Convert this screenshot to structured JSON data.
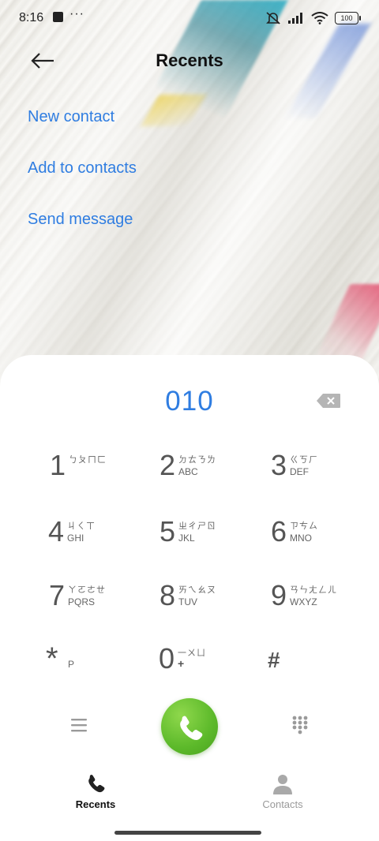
{
  "status_bar": {
    "time": "8:16",
    "more": "···",
    "battery": "100"
  },
  "header": {
    "title": "Recents"
  },
  "actions": {
    "new_contact": "New contact",
    "add_to_contacts": "Add to contacts",
    "send_message": "Send message"
  },
  "dialer": {
    "number": "010",
    "keys": [
      {
        "digit": "1",
        "zhuyin": "ㄅㄆㄇㄈ",
        "letters": ""
      },
      {
        "digit": "2",
        "zhuyin": "ㄉㄊㄋㄌ",
        "letters": "ABC"
      },
      {
        "digit": "3",
        "zhuyin": "ㄍㄎㄏ",
        "letters": "DEF"
      },
      {
        "digit": "4",
        "zhuyin": "ㄐㄑㄒ",
        "letters": "GHI"
      },
      {
        "digit": "5",
        "zhuyin": "ㄓㄔㄕㄖ",
        "letters": "JKL"
      },
      {
        "digit": "6",
        "zhuyin": "ㄗㄘㄙ",
        "letters": "MNO"
      },
      {
        "digit": "7",
        "zhuyin": "ㄚㄛㄜㄝ",
        "letters": "PQRS"
      },
      {
        "digit": "8",
        "zhuyin": "ㄞㄟㄠㄡ",
        "letters": "TUV"
      },
      {
        "digit": "9",
        "zhuyin": "ㄢㄣㄤㄥㄦ",
        "letters": "WXYZ"
      },
      {
        "digit": "*",
        "zhuyin": "",
        "letters": "P"
      },
      {
        "digit": "0",
        "zhuyin": "一ㄨㄩ",
        "letters": "+"
      },
      {
        "digit": "#",
        "zhuyin": "",
        "letters": ""
      }
    ]
  },
  "nav": {
    "recents": "Recents",
    "contacts": "Contacts"
  },
  "colors": {
    "accent": "#2f7de1",
    "call_green": "#5cb92a",
    "sheet": "#ffffff"
  }
}
